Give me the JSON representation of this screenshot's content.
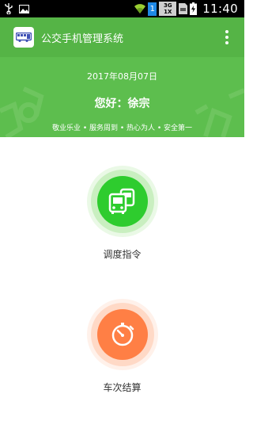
{
  "status_bar": {
    "time": "11:40",
    "sim_label": "1",
    "network_top": "3G",
    "network_bottom": "1X",
    "icons": [
      "usb-icon",
      "image-icon",
      "wifi-icon",
      "sim-icon",
      "network-icon",
      "sd-card-icon",
      "battery-charging-icon"
    ]
  },
  "toolbar": {
    "title": "公交手机管理系统",
    "app_icon": "bus-icon",
    "menu_icon": "more-vertical-icon"
  },
  "header": {
    "date": "2017年08月07日",
    "greeting": "您好：徐宗",
    "motto": "敬业乐业 • 服务周到 • 热心为人 • 安全第一"
  },
  "actions": [
    {
      "label": "调度指令",
      "icon": "bus-dispatch-icon",
      "color": "#2ecc2e"
    },
    {
      "label": "车次结算",
      "icon": "clock-icon",
      "color": "#ff7f45"
    }
  ],
  "colors": {
    "header_green": "#5dbe4e",
    "toolbar_green": "#55b446",
    "dispatch_green": "#2ecc2e",
    "settlement_orange": "#ff7f45"
  }
}
